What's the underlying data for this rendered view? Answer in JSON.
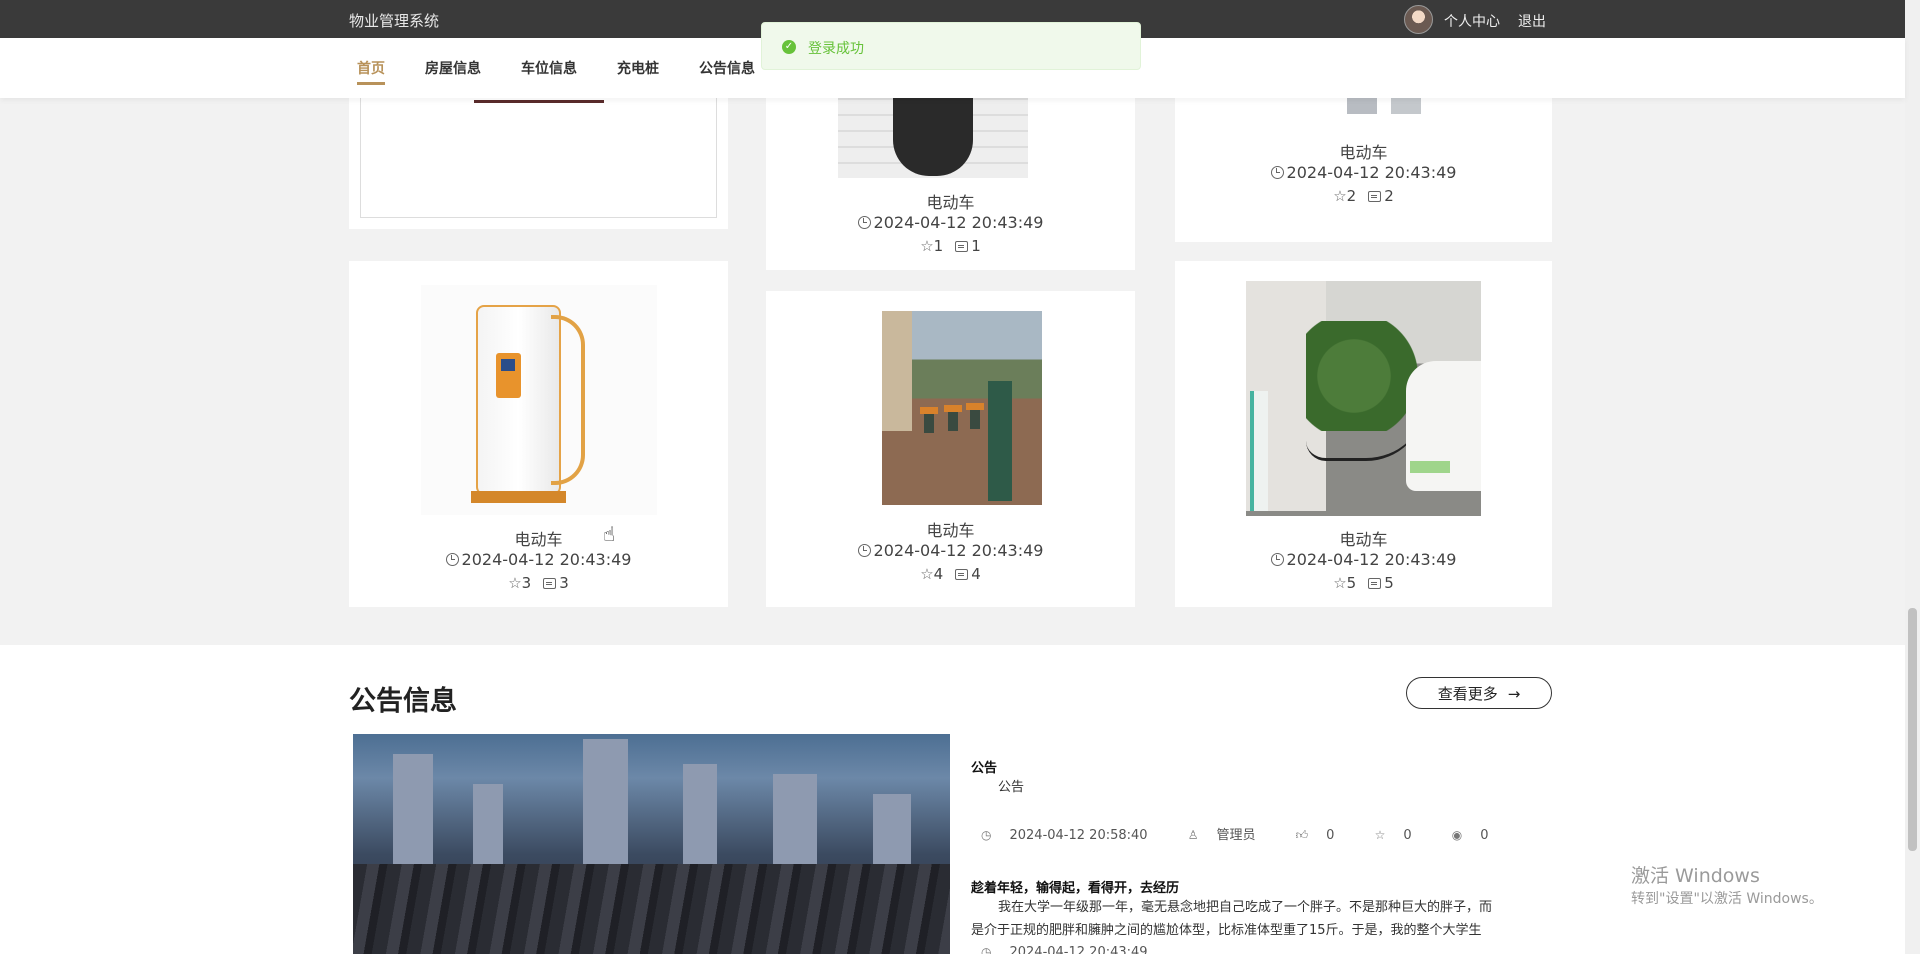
{
  "topbar": {
    "title": "物业管理系统",
    "profile": "个人中心",
    "logout": "退出"
  },
  "nav": {
    "items": [
      "首页",
      "房屋信息",
      "车位信息",
      "充电桩",
      "公告信息"
    ],
    "active": 0
  },
  "toast": {
    "message": "登录成功",
    "icon": "check-circle-icon",
    "color": "#67c23a"
  },
  "cards": [
    {
      "name": "电动车",
      "time": "2024-04-12 20:43:49",
      "likes": "1",
      "comments": "1"
    },
    {
      "name": "电动车",
      "time": "2024-04-12 20:43:49",
      "likes": "2",
      "comments": "2"
    },
    {
      "name": "电动车",
      "time": "2024-04-12 20:43:49",
      "likes": "3",
      "comments": "3"
    },
    {
      "name": "电动车",
      "time": "2024-04-12 20:43:49",
      "likes": "4",
      "comments": "4"
    },
    {
      "name": "电动车",
      "time": "2024-04-12 20:43:49",
      "likes": "5",
      "comments": "5"
    }
  ],
  "notices": {
    "section_title": "公告信息",
    "more": "查看更多",
    "more_arrow": "→",
    "items": [
      {
        "title": "公告",
        "body": "公告",
        "time": "2024-04-12 20:58:40",
        "author": "管理员",
        "likes": "0",
        "stars": "0",
        "views": "0"
      },
      {
        "title": "趁着年轻，输得起，看得开，去经历",
        "body1": "我在大学一年级那一年，毫无悬念地把自己吃成了一个胖子。不是那种巨大的胖子，而",
        "body2": "是介于正规的肥胖和臃肿之间的尴尬体型，比标准体型重了15斤。于是，我的整个大学生",
        "meta": "2024-04-12 20:43:49"
      }
    ]
  },
  "watermark": {
    "line1": "激活 Windows",
    "line2": "转到\"设置\"以激活 Windows。"
  },
  "colors": {
    "topbar": "#3a3a3a",
    "accent": "#b8925a",
    "background": "#f2f2f2"
  }
}
